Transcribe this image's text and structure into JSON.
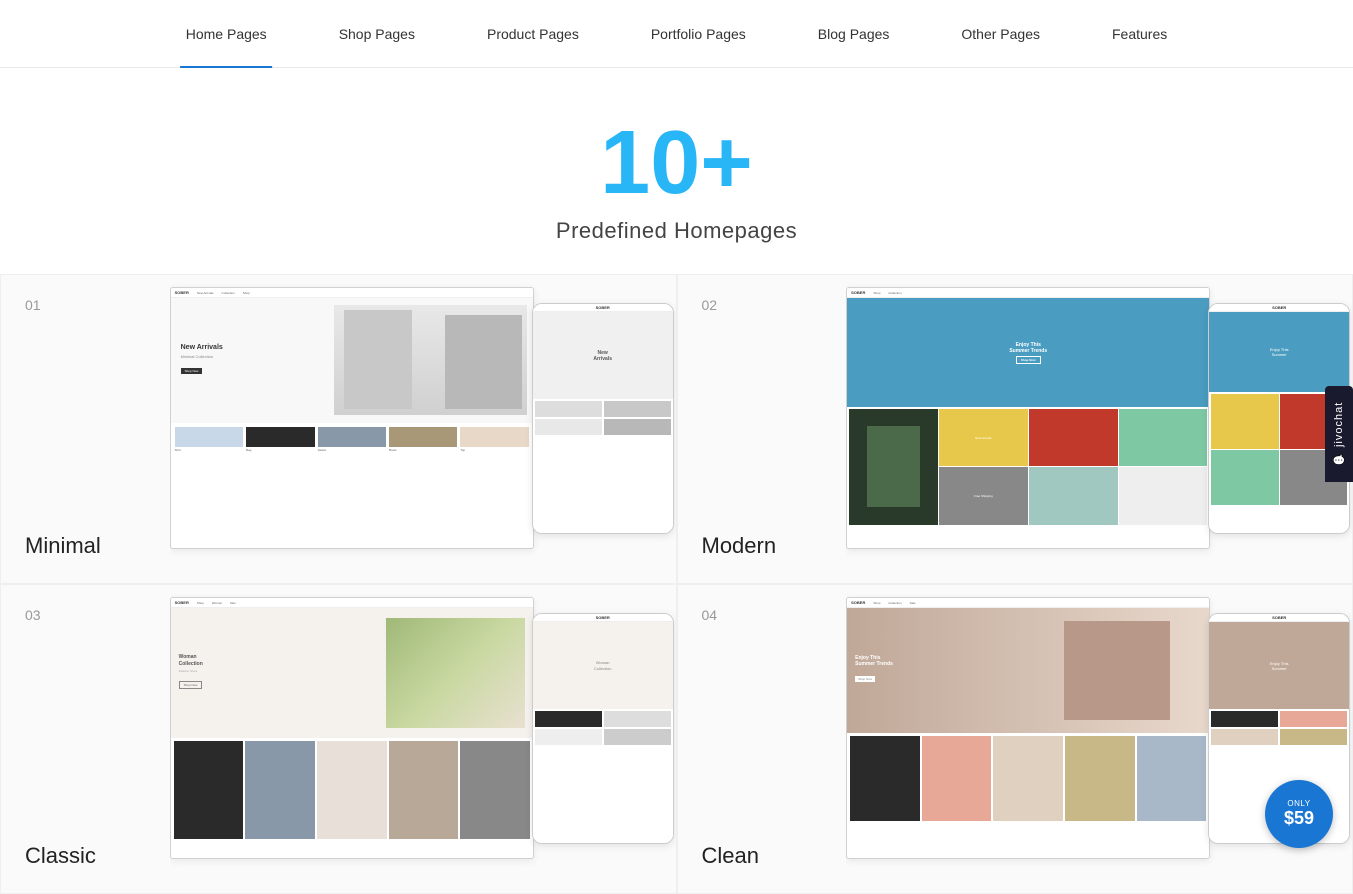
{
  "nav": {
    "items": [
      {
        "id": "home-pages",
        "label": "Home Pages",
        "active": true
      },
      {
        "id": "shop-pages",
        "label": "Shop Pages",
        "active": false
      },
      {
        "id": "product-pages",
        "label": "Product Pages",
        "active": false
      },
      {
        "id": "portfolio-pages",
        "label": "Portfolio Pages",
        "active": false
      },
      {
        "id": "blog-pages",
        "label": "Blog Pages",
        "active": false
      },
      {
        "id": "other-pages",
        "label": "Other Pages",
        "active": false
      },
      {
        "id": "features",
        "label": "Features",
        "active": false
      }
    ]
  },
  "hero": {
    "count": "10+",
    "subtitle": "Predefined Homepages"
  },
  "cards": [
    {
      "number": "01",
      "label": "Minimal",
      "type": "minimal"
    },
    {
      "number": "02",
      "label": "Modern",
      "type": "modern"
    },
    {
      "number": "03",
      "label": "Classic",
      "type": "classic"
    },
    {
      "number": "04",
      "label": "Clean",
      "type": "clean"
    }
  ],
  "jivochat": {
    "label": "jivochat"
  },
  "price_badge": {
    "only_label": "ONLY",
    "price": "$59"
  }
}
